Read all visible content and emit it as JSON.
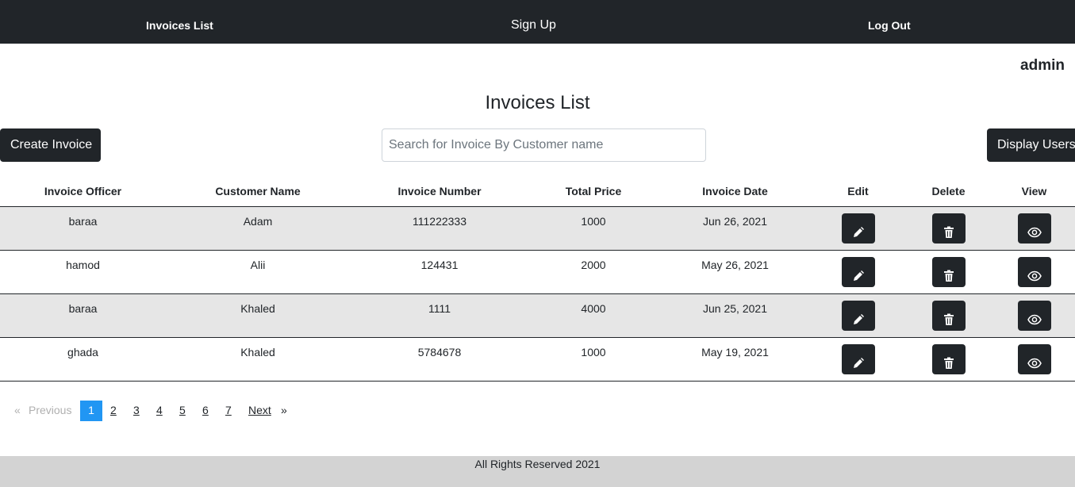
{
  "nav": {
    "invoices_list": "Invoices List",
    "sign_up": "Sign Up",
    "log_out": "Log Out"
  },
  "user": {
    "name": "admin"
  },
  "page": {
    "title": "Invoices List"
  },
  "toolbar": {
    "create_label": "Create Invoice",
    "display_users_label": "Display Users",
    "search_placeholder": "Search for Invoice By Customer name",
    "search_value": ""
  },
  "table": {
    "headers": [
      "Invoice Officer",
      "Customer Name",
      "Invoice Number",
      "Total Price",
      "Invoice Date",
      "Edit",
      "Delete",
      "View"
    ],
    "rows": [
      {
        "officer": "baraa",
        "customer": "Adam",
        "number": "111222333",
        "total": "1000",
        "date": "Jun 26, 2021"
      },
      {
        "officer": "hamod",
        "customer": "Alii",
        "number": "124431",
        "total": "2000",
        "date": "May 26, 2021"
      },
      {
        "officer": "baraa",
        "customer": "Khaled",
        "number": "1111",
        "total": "4000",
        "date": "Jun 25, 2021"
      },
      {
        "officer": "ghada",
        "customer": "Khaled",
        "number": "5784678",
        "total": "1000",
        "date": "May 19, 2021"
      }
    ],
    "icons": {
      "edit": "pencil-icon",
      "delete": "trash-icon",
      "view": "eye-icon"
    }
  },
  "pagination": {
    "prev_arrow": "«",
    "previous": "Previous",
    "pages": [
      "1",
      "2",
      "3",
      "4",
      "5",
      "6",
      "7"
    ],
    "current_page": "1",
    "next": "Next",
    "next_arrow": "»"
  },
  "footer": {
    "text": "All Rights Reserved 2021"
  },
  "colors": {
    "navbar": "#212529",
    "button": "#212529",
    "row_shade": "#e6e6e6",
    "active_page": "#2196f3",
    "footer": "#d3d3d3"
  }
}
